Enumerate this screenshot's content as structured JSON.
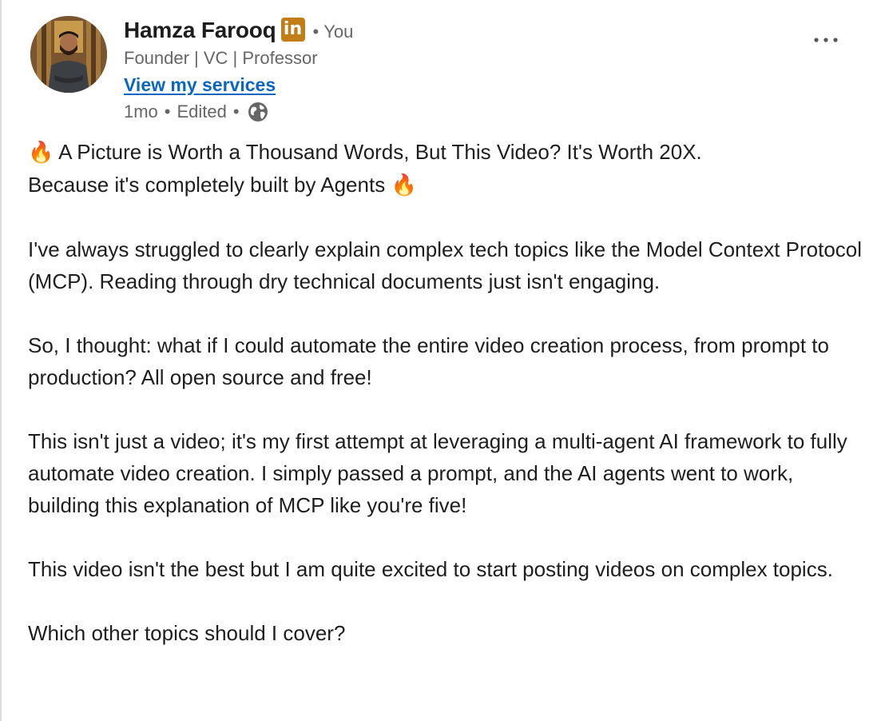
{
  "author": {
    "name": "Hamza Farooq",
    "badge_text": "in",
    "relation": "You",
    "separator": "•",
    "headline": "Founder | VC | Professor",
    "services_link": "View my services"
  },
  "post_meta": {
    "age": "1mo",
    "edited": "Edited",
    "separator": "•",
    "visibility_icon": "globe-icon"
  },
  "menu": {
    "icon": "more-horizontal-icon"
  },
  "post": {
    "paragraphs": [
      {
        "lead_emoji": "🔥",
        "text": "A Picture is Worth a Thousand Words, But This Video? It's Worth 20X.\nBecause it's completely built by Agents ",
        "trail_emoji": "🔥"
      },
      {
        "text": "I've always struggled to clearly explain complex tech topics like the Model Context Protocol (MCP). Reading through dry technical documents just isn't engaging."
      },
      {
        "text": "So, I thought: what if I could automate the entire video creation process, from prompt to production? All open source and free!"
      },
      {
        "text": "This isn't just a video; it's my first attempt at leveraging a multi-agent AI framework to fully automate video creation. I simply passed a prompt, and the AI agents went to work, building this explanation of MCP like you're five!"
      },
      {
        "text": "This video isn't the best but I am quite excited to start posting videos on complex topics."
      },
      {
        "text": "Which other topics should I cover?"
      }
    ]
  },
  "colors": {
    "link": "#0a66c2",
    "badge": "#c37d16",
    "muted": "#666666",
    "text": "#1e1e1e"
  }
}
